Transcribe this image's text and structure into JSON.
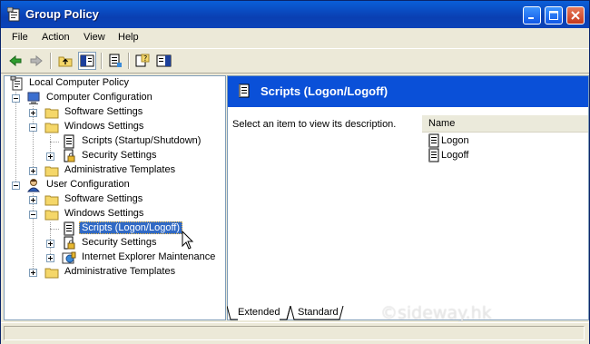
{
  "window": {
    "title": "Group Policy",
    "accent": "#0a50d8"
  },
  "menu": {
    "items": [
      {
        "label": "File"
      },
      {
        "label": "Action"
      },
      {
        "label": "View"
      },
      {
        "label": "Help"
      }
    ]
  },
  "toolbar": {
    "icons": [
      "back-arrow-icon",
      "forward-arrow-icon",
      "up-folder-icon",
      "show-hide-tree-icon",
      "export-list-icon",
      "help-icon",
      "show-hide-action-pane-icon"
    ]
  },
  "tree": {
    "root": "Local Computer Policy",
    "computer_config": "Computer Configuration",
    "cc_software": "Software Settings",
    "cc_windows": "Windows Settings",
    "cc_scripts": "Scripts (Startup/Shutdown)",
    "cc_security": "Security Settings",
    "cc_admin": "Administrative Templates",
    "user_config": "User Configuration",
    "uc_software": "Software Settings",
    "uc_windows": "Windows Settings",
    "uc_scripts": "Scripts (Logon/Logoff)",
    "uc_security": "Security Settings",
    "uc_ie": "Internet Explorer Maintenance",
    "uc_admin": "Administrative Templates",
    "selected": "Scripts (Logon/Logoff)"
  },
  "detail": {
    "header_title": "Scripts (Logon/Logoff)",
    "description": "Select an item to view its description.",
    "column_name": "Name",
    "items": [
      {
        "label": "Logon"
      },
      {
        "label": "Logoff"
      }
    ]
  },
  "tabs": {
    "extended": "Extended",
    "standard": "Standard",
    "active": "Extended"
  },
  "watermark": "©sideway.hk"
}
